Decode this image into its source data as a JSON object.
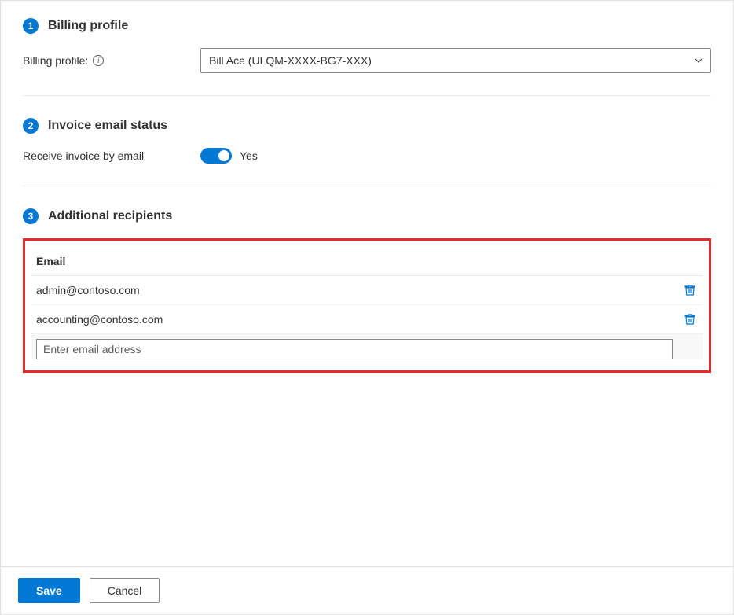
{
  "sections": {
    "billing_profile": {
      "step": "1",
      "title": "Billing profile",
      "field_label": "Billing profile:",
      "selected_value": "Bill Ace (ULQM-XXXX-BG7-XXX)"
    },
    "invoice_email": {
      "step": "2",
      "title": "Invoice email status",
      "field_label": "Receive invoice by email",
      "toggle_state": "Yes"
    },
    "additional_recipients": {
      "step": "3",
      "title": "Additional recipients",
      "table_header": "Email",
      "recipients": [
        "admin@contoso.com",
        "accounting@contoso.com"
      ],
      "input_placeholder": "Enter email address"
    }
  },
  "footer": {
    "save_label": "Save",
    "cancel_label": "Cancel"
  }
}
